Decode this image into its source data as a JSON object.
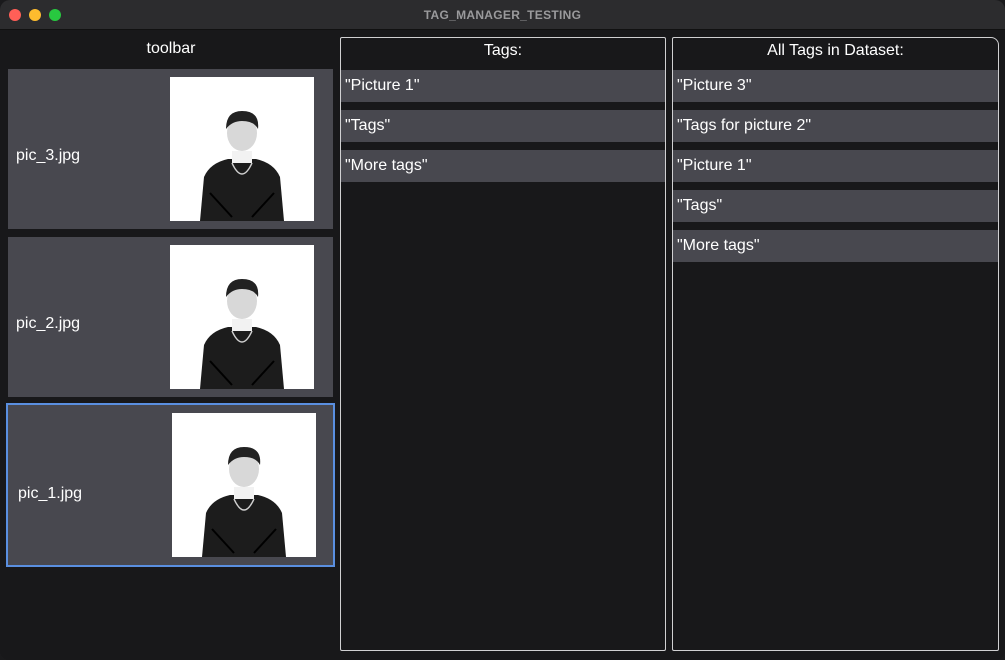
{
  "window": {
    "title": "TAG_MANAGER_TESTING"
  },
  "toolbar": {
    "title": "toolbar",
    "images": [
      {
        "filename": "pic_3.jpg",
        "selected": false
      },
      {
        "filename": "pic_2.jpg",
        "selected": false
      },
      {
        "filename": "pic_1.jpg",
        "selected": true
      }
    ]
  },
  "tags_panel": {
    "title": "Tags:",
    "tags": [
      "\"Picture 1\"",
      "\"Tags\"",
      "\"More tags\""
    ]
  },
  "all_tags_panel": {
    "title": "All Tags in Dataset:",
    "tags": [
      "\"Picture 3\"",
      "\"Tags for picture 2\"",
      "\"Picture 1\"",
      "\"Tags\"",
      "\"More tags\""
    ]
  },
  "colors": {
    "selection_border": "#5a8fe0",
    "item_background": "#48484f",
    "window_background": "#18181a"
  }
}
